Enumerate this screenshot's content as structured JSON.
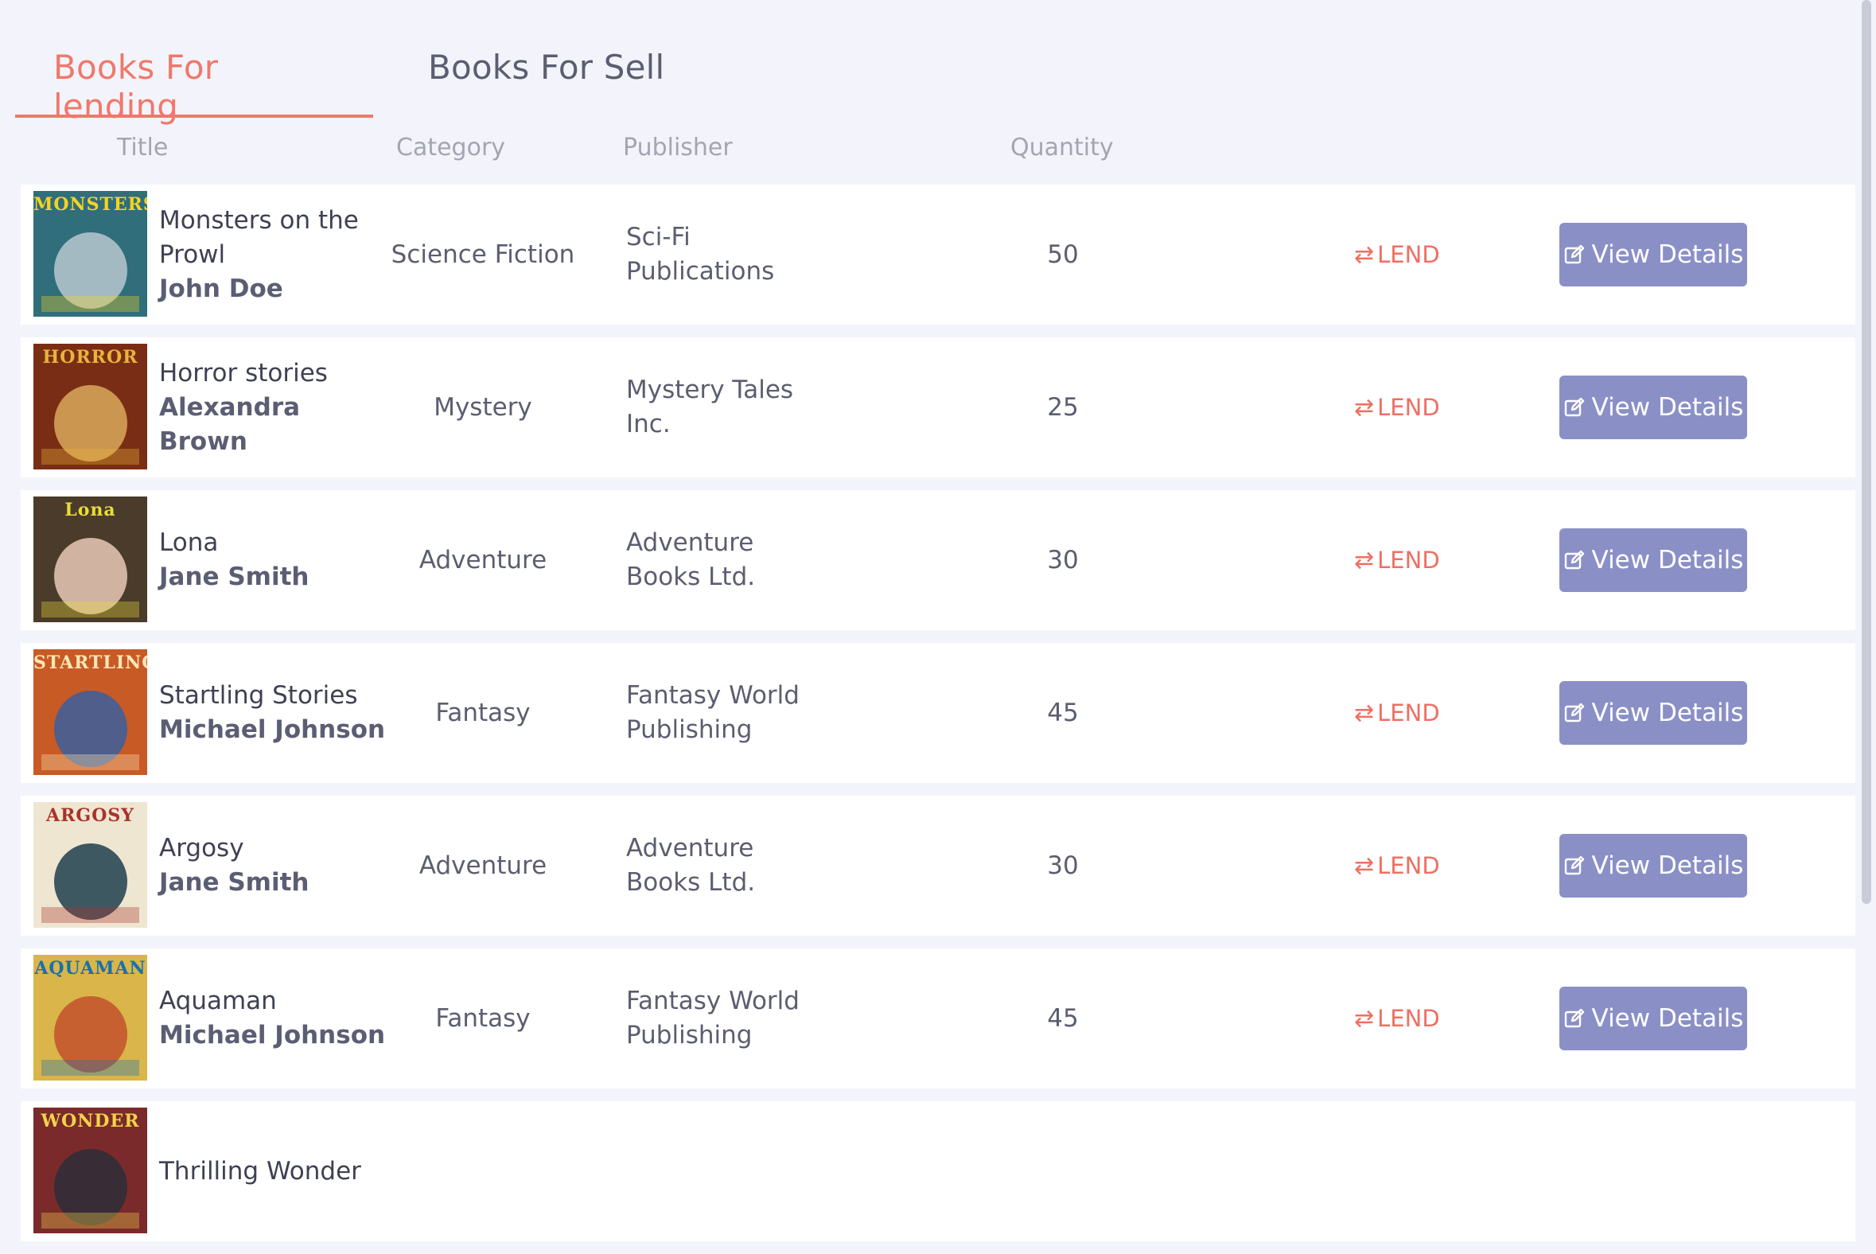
{
  "tabs": [
    {
      "label": "Books For lending",
      "active": true
    },
    {
      "label": "Books For Sell",
      "active": false
    }
  ],
  "columns": {
    "title": "Title",
    "category": "Category",
    "publisher": "Publisher",
    "quantity": "Quantity"
  },
  "actions": {
    "lend_label": "LEND",
    "view_label": "View Details"
  },
  "books": [
    {
      "title": "Monsters on the Prowl",
      "author": "John Doe",
      "category": "Science Fiction",
      "publisher": "Sci-Fi Publications",
      "quantity": "50",
      "cover_mast": "MONSTERS",
      "cover_bg": "#2f6e7a",
      "cover_mast_color": "#f5d321",
      "cover_art": "#b9c8cf"
    },
    {
      "title": "Horror stories",
      "author": "Alexandra Brown",
      "category": "Mystery",
      "publisher": "Mystery Tales Inc.",
      "quantity": "25",
      "cover_mast": "HORROR",
      "cover_bg": "#7a2d15",
      "cover_mast_color": "#e8b43a",
      "cover_art": "#d9a95a"
    },
    {
      "title": "Lona",
      "author": "Jane Smith",
      "category": "Adventure",
      "publisher": "Adventure Books Ltd.",
      "quantity": "30",
      "cover_mast": "Lona",
      "cover_bg": "#4a3b2a",
      "cover_mast_color": "#e7dd3a",
      "cover_art": "#e8c9b6"
    },
    {
      "title": "Startling Stories",
      "author": "Michael Johnson",
      "category": "Fantasy",
      "publisher": "Fantasy World Publishing",
      "quantity": "45",
      "cover_mast": "STARTLING",
      "cover_bg": "#c85a26",
      "cover_mast_color": "#fbe7b5",
      "cover_art": "#3b5f9d"
    },
    {
      "title": "Argosy",
      "author": "Jane Smith",
      "category": "Adventure",
      "publisher": "Adventure Books Ltd.",
      "quantity": "30",
      "cover_mast": "ARGOSY",
      "cover_bg": "#efe6d2",
      "cover_mast_color": "#a8332a",
      "cover_art": "#1f3e4d"
    },
    {
      "title": "Aquaman",
      "author": "Michael Johnson",
      "category": "Fantasy",
      "publisher": "Fantasy World Publishing",
      "quantity": "45",
      "cover_mast": "AQUAMAN",
      "cover_bg": "#d9b54a",
      "cover_mast_color": "#1a6fb1",
      "cover_art": "#c2512d"
    },
    {
      "title": "Thrilling Wonder",
      "author": "",
      "category": "",
      "publisher": "",
      "quantity": "",
      "cover_mast": "WONDER",
      "cover_bg": "#7a2a2a",
      "cover_mast_color": "#f2d34a",
      "cover_art": "#2d2d3a"
    }
  ],
  "colors": {
    "accent": "#f0786b",
    "button": "#8a90c6",
    "background": "#f3f4fb"
  }
}
